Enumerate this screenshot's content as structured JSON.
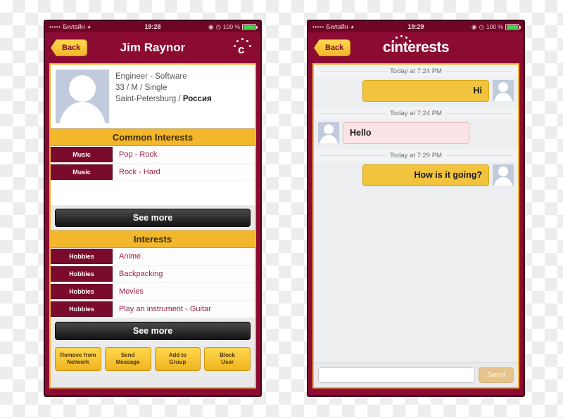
{
  "profile_phone": {
    "statusbar": {
      "signal_dots": "•••••",
      "carrier": "Билайн",
      "wifi_icon": "wifi-icon",
      "time": "19:28",
      "battery_percent": "100 %"
    },
    "navbar": {
      "back_label": "Back",
      "title": "Jim Raynor",
      "logo_icon": "cinterests-c-logo-icon"
    },
    "profile": {
      "avatar_icon": "person-silhouette-avatar",
      "occupation": "Engineer - Software",
      "demographics": "33 / M / Single",
      "location_city": "Saint-Petersburg / ",
      "location_country": "Россия"
    },
    "common_interests": {
      "heading": "Common Interests",
      "rows": [
        {
          "category": "Music",
          "value": "Pop - Rock"
        },
        {
          "category": "Music",
          "value": "Rock - Hard"
        }
      ],
      "see_more_label": "See more"
    },
    "interests": {
      "heading": "Interests",
      "rows": [
        {
          "category": "Hobbies",
          "value": "Anime"
        },
        {
          "category": "Hobbies",
          "value": "Backpacking"
        },
        {
          "category": "Hobbies",
          "value": "Movies"
        },
        {
          "category": "Hobbies",
          "value": "Play an instrument - Guitar"
        }
      ],
      "see_more_label": "See more"
    },
    "actions": [
      {
        "line1": "Remove from",
        "line2": "Network"
      },
      {
        "line1": "Send",
        "line2": "Message"
      },
      {
        "line1": "Add to",
        "line2": "Group"
      },
      {
        "line1": "Block",
        "line2": "User"
      }
    ]
  },
  "chat_phone": {
    "statusbar": {
      "signal_dots": "•••••",
      "carrier": "Билайн",
      "wifi_icon": "wifi-icon",
      "time": "19:29",
      "battery_percent": "100 %"
    },
    "navbar": {
      "back_label": "Back",
      "brand": "cinterests"
    },
    "messages": [
      {
        "timestamp": "Today at 7:24 PM",
        "text": "Hi",
        "direction": "out"
      },
      {
        "timestamp": "Today at 7:24 PM",
        "text": "Hello",
        "direction": "in"
      },
      {
        "timestamp": "Today at 7:29 PM",
        "text": "How is it going?",
        "direction": "out"
      }
    ],
    "input": {
      "value": "",
      "placeholder": "",
      "send_label": "Send"
    }
  },
  "colors": {
    "brand_maroon": "#8c0b33",
    "brand_gold": "#f2b72a",
    "chip_maroon": "#7a0b2c",
    "bubble_out": "#f2c33d",
    "bubble_in": "#fbe3e6"
  }
}
